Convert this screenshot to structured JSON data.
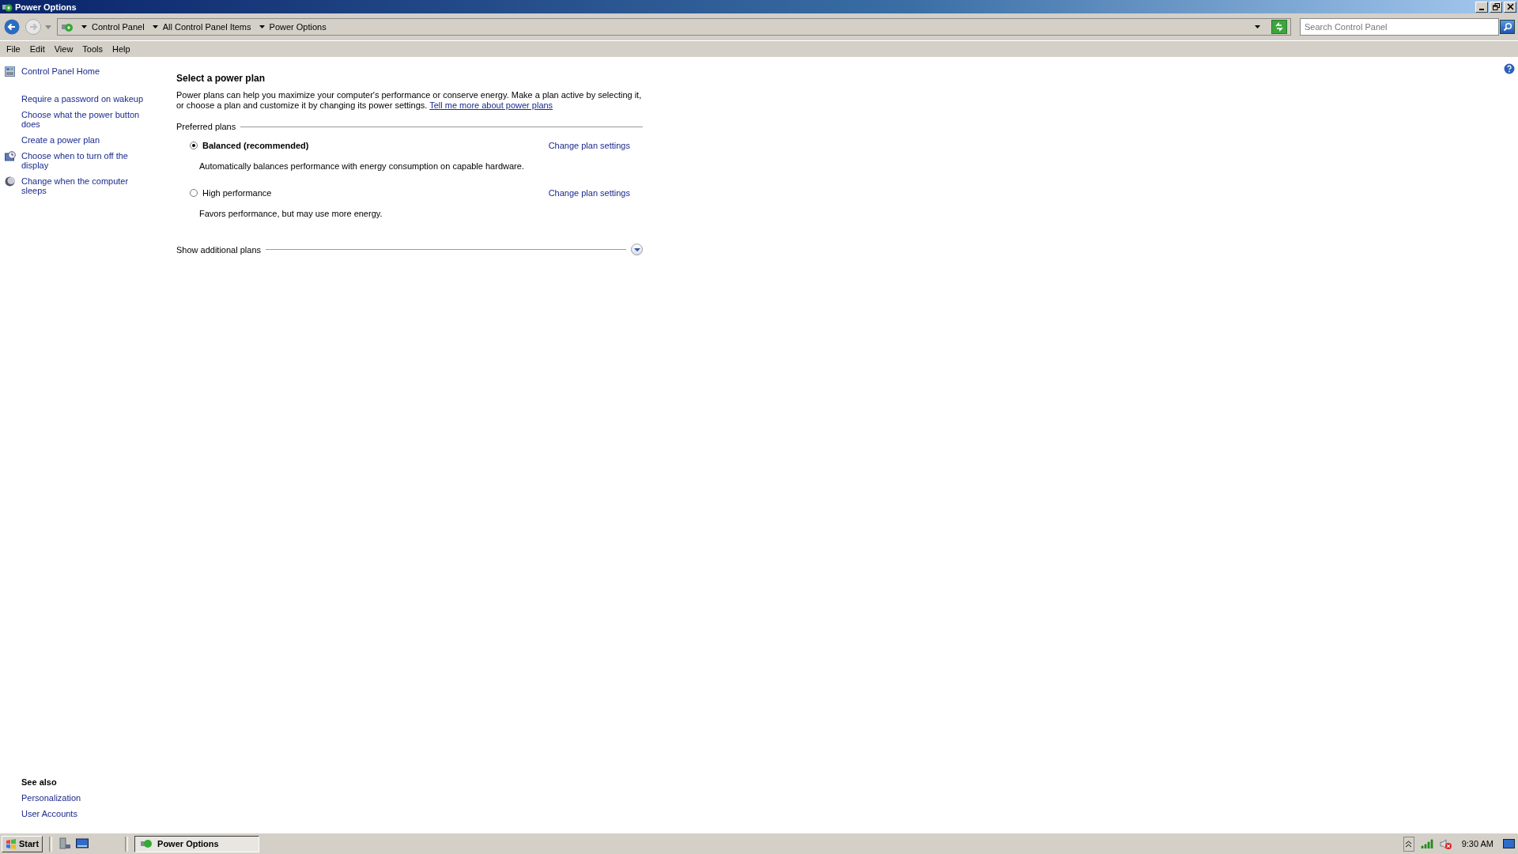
{
  "window": {
    "title": "Power Options"
  },
  "address_bar": {
    "breadcrumbs": [
      "Control Panel",
      "All Control Panel Items",
      "Power Options"
    ]
  },
  "search": {
    "placeholder": "Search Control Panel"
  },
  "menu": [
    "File",
    "Edit",
    "View",
    "Tools",
    "Help"
  ],
  "sidebar": {
    "items": [
      {
        "label": "Control Panel Home",
        "kind": "home"
      },
      {
        "label": "Require a password on wakeup",
        "kind": "plain"
      },
      {
        "label": "Choose what the power button does",
        "kind": "plain"
      },
      {
        "label": "Create a power plan",
        "kind": "plain"
      },
      {
        "label": "Choose when to turn off the display",
        "kind": "display"
      },
      {
        "label": "Change when the computer sleeps",
        "kind": "sleep"
      }
    ],
    "see_also": {
      "title": "See also",
      "links": [
        "Personalization",
        "User Accounts"
      ]
    }
  },
  "content": {
    "heading": "Select a power plan",
    "intro": "Power plans can help you maximize your computer's performance or conserve energy. Make a plan active by selecting it, or choose a plan and customize it by changing its power settings.",
    "intro_link": "Tell me more about power plans",
    "group_label": "Preferred plans",
    "plans": [
      {
        "name": "Balanced (recommended)",
        "selected": true,
        "description": "Automatically balances performance with energy consumption on capable hardware.",
        "link": "Change plan settings"
      },
      {
        "name": "High performance",
        "selected": false,
        "description": "Favors performance, but may use more energy.",
        "link": "Change plan settings"
      }
    ],
    "more": {
      "label": "Show additional plans",
      "expanded": false
    }
  },
  "taskbar": {
    "start": "Start",
    "tasks": [
      {
        "label": "Power Options",
        "selected": true
      }
    ],
    "clock": "9:30 AM"
  }
}
